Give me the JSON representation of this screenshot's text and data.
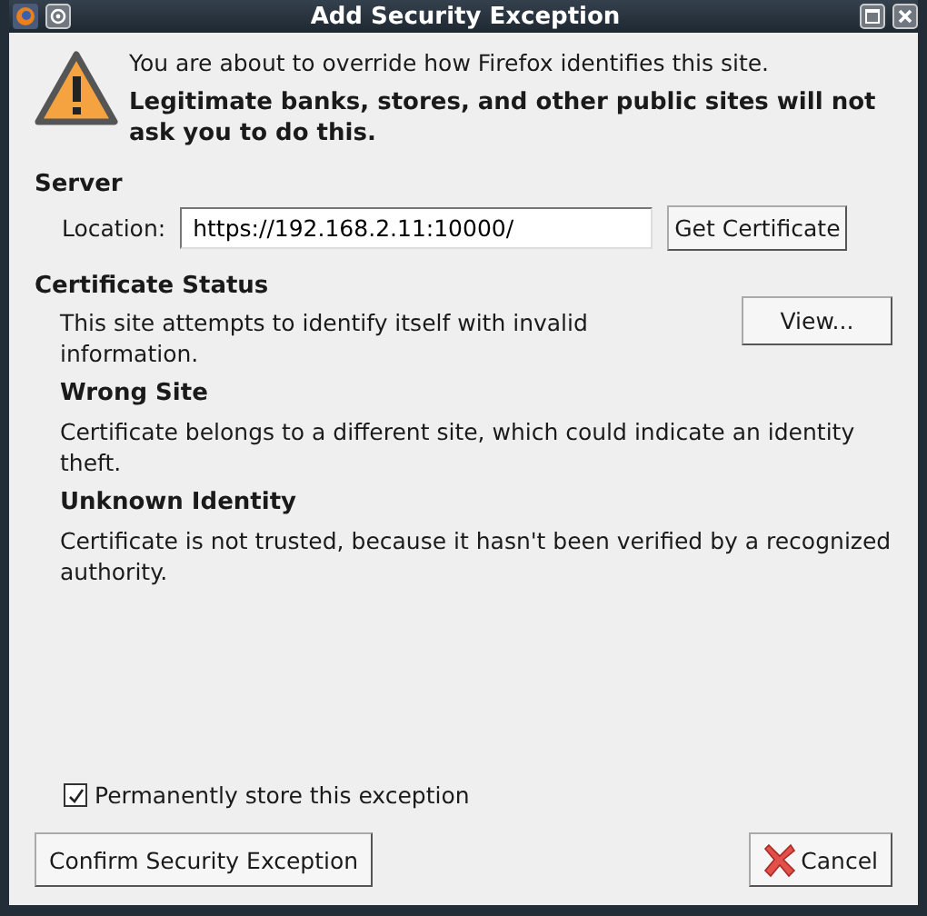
{
  "window": {
    "title": "Add Security Exception"
  },
  "intro": {
    "message": "You are about to override how Firefox identifies this site.",
    "warning": "Legitimate banks, stores, and other public sites will not ask you to do this."
  },
  "server": {
    "heading": "Server",
    "location_label": "Location:",
    "location_value": "https://192.168.2.11:10000/",
    "get_button": "Get Certificate"
  },
  "certificate_status": {
    "heading": "Certificate Status",
    "summary": "This site attempts to identify itself with invalid information.",
    "view_button": "View...",
    "problems": [
      {
        "title": "Wrong Site",
        "description": "Certificate belongs to a different site, which could indicate an identity theft."
      },
      {
        "title": "Unknown Identity",
        "description": "Certificate is not trusted, because it hasn't been verified by a recognized authority."
      }
    ]
  },
  "permanent": {
    "label": "Permanently store this exception",
    "checked": true
  },
  "buttons": {
    "confirm": "Confirm Security Exception",
    "cancel": "Cancel"
  }
}
